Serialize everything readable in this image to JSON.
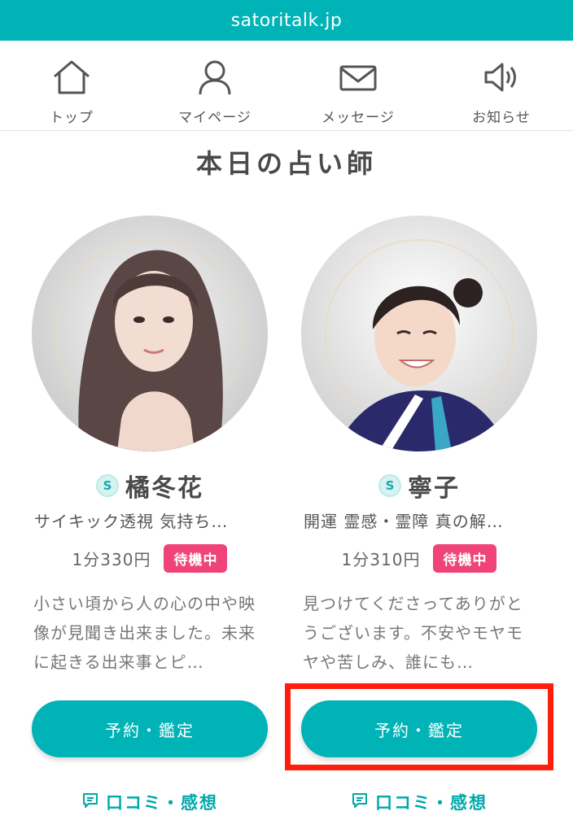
{
  "browser": {
    "url": "satoritalk.jp"
  },
  "nav": {
    "items": [
      {
        "label": "トップ",
        "icon": "home-icon"
      },
      {
        "label": "マイページ",
        "icon": "user-icon"
      },
      {
        "label": "メッセージ",
        "icon": "mail-icon"
      },
      {
        "label": "お知らせ",
        "icon": "speaker-icon"
      }
    ]
  },
  "section": {
    "title": "本日の占い師"
  },
  "fortune_tellers": [
    {
      "badge": "S",
      "name": "橘冬花",
      "tags": "サイキック透視 気持ち…",
      "price": "1分330円",
      "status": "待機中",
      "description": "小さい頃から人の心の中や映像が見聞き出来ました。未来に起きる出来事とピ…",
      "reserve_label": "予約・鑑定",
      "review_label": "口コミ・感想"
    },
    {
      "badge": "S",
      "name": "寧子",
      "tags": "開運 霊感・霊障 真の解…",
      "price": "1分310円",
      "status": "待機中",
      "description": "見つけてくださってありがとうございます。不安やモヤモヤや苦しみ、誰にも…",
      "reserve_label": "予約・鑑定",
      "review_label": "口コミ・感想"
    }
  ],
  "colors": {
    "accent": "#00b3b6",
    "status_badge": "#f0437a",
    "highlight": "#ff1e0c"
  }
}
